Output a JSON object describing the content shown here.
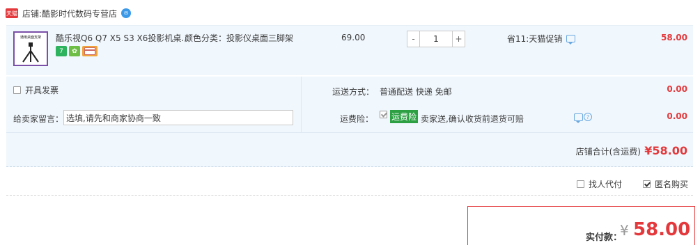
{
  "shop": {
    "badge": "天猫",
    "label": "店铺:",
    "name": "酷影时代数码专营店",
    "ww_icon": "ww-chat-icon"
  },
  "item": {
    "thumb_caption": "通用桌面支架",
    "title": "酷乐视Q6 Q7 X5 S3 X6投影机桌...",
    "sku": "颜色分类：投影仪桌面三脚架",
    "price": "69.00",
    "qty": {
      "minus": "-",
      "value": "1",
      "plus": "+"
    },
    "promo": "省11:天猫促销",
    "subtotal": "58.00",
    "service_icons": [
      "7",
      "✿",
      ""
    ]
  },
  "options": {
    "invoice_label": "开具发票",
    "message_label": "给卖家留言：",
    "message_value": "选填,请先和商家协商一致",
    "shipping_label": "运送方式：",
    "shipping_value": "普通配送 快递 免邮",
    "shipping_price": "0.00",
    "insurance_label": "运费险：",
    "insurance_tag": "运费险",
    "insurance_text": "卖家送,确认收货前退货可赔",
    "insurance_price": "0.00",
    "total_label": "店铺合计(含运费)",
    "total_amount": "¥58.00"
  },
  "extras": {
    "proxy_pay_label": "找人代付",
    "anonymous_label": "匿名购买",
    "anonymous_checked": true
  },
  "payment": {
    "label": "实付款：",
    "currency": "¥",
    "amount": "58.00"
  },
  "colors": {
    "accent_red": "#e4393c",
    "row_bg": "#f0f7fd",
    "link_blue": "#3c99e8",
    "insurance_green": "#2da044"
  }
}
